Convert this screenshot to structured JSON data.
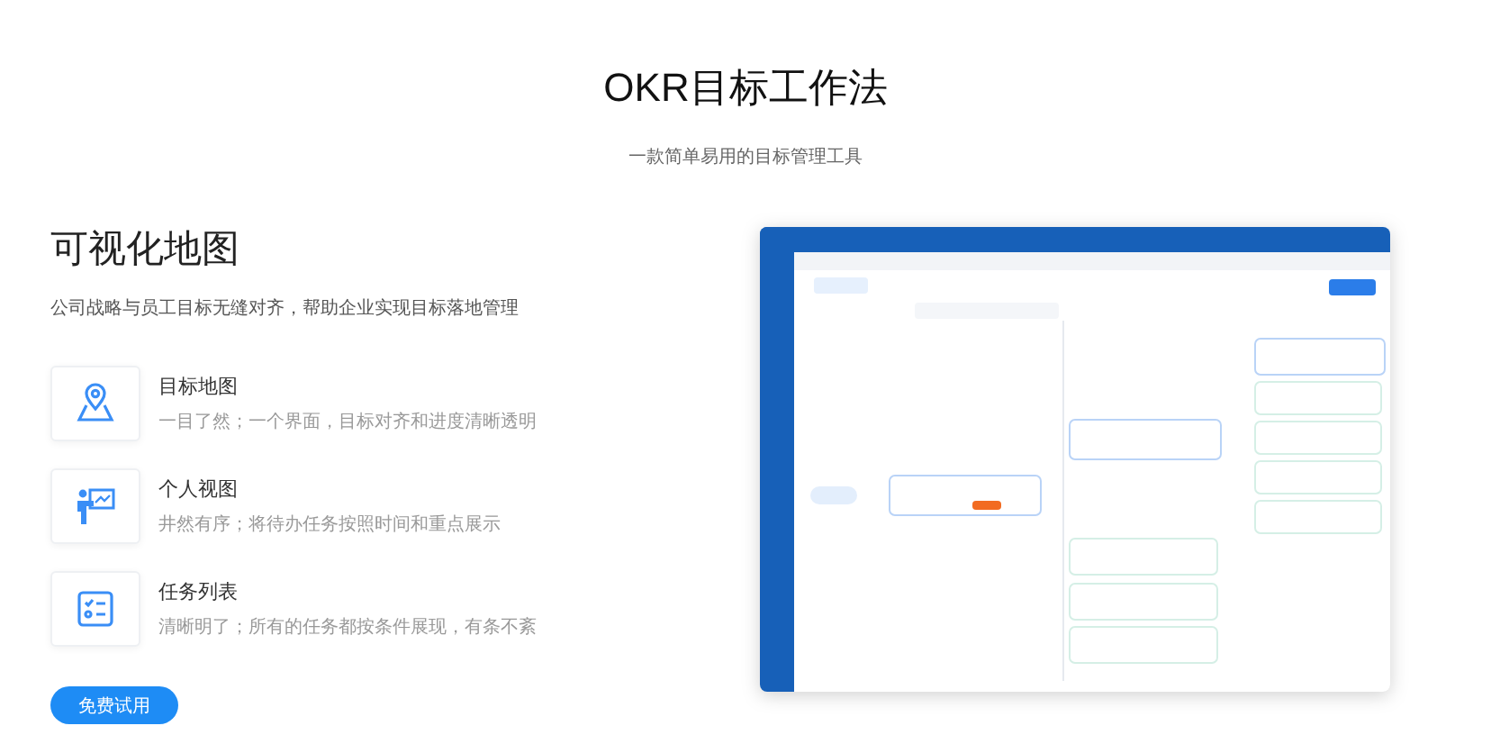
{
  "header": {
    "title": "OKR目标工作法",
    "subtitle": "一款简单易用的目标管理工具"
  },
  "section": {
    "heading": "可视化地图",
    "description": "公司战略与员工目标无缝对齐，帮助企业实现目标落地管理",
    "features": [
      {
        "kind": "map",
        "title": "目标地图",
        "description": "一目了然；一个界面，目标对齐和进度清晰透明"
      },
      {
        "kind": "person",
        "title": "个人视图",
        "description": "井然有序；将待办任务按照时间和重点展示"
      },
      {
        "kind": "list",
        "title": "任务列表",
        "description": "清晰明了；所有的任务都按条件展现，有条不紊"
      }
    ],
    "button": "免费试用"
  }
}
